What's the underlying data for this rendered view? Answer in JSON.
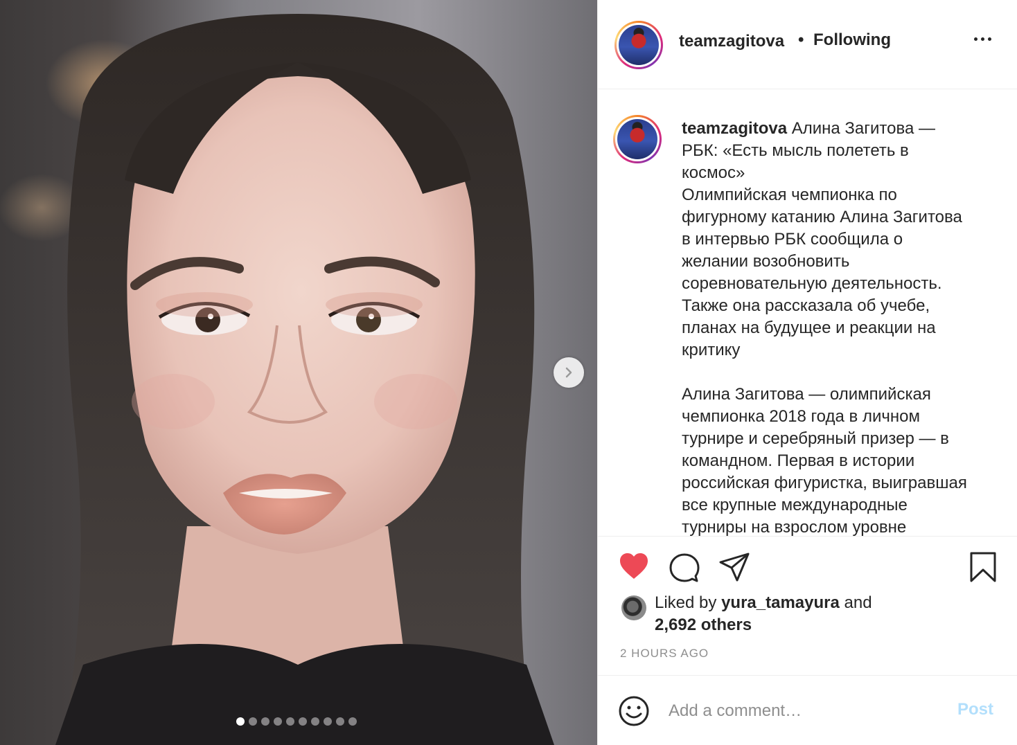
{
  "post": {
    "username": "teamzagitova",
    "separator": "•",
    "follow_status": "Following",
    "caption_lines": [
      "Алина Загитова —",
      "РБК: «Есть мысль полететь в",
      "космос»",
      "Олимпийская чемпионка по",
      "фигурному катанию Алина Загитова",
      "в интервью РБК сообщила о",
      "желании возобновить",
      "соревновательную деятельность.",
      "Также она рассказала об учебе,",
      "планах на будущее и реакции на",
      "критику",
      "",
      "Алина Загитова — олимпийская",
      "чемпионка 2018 года в личном",
      "турнире и серебряный призер — в",
      "командном. Первая в истории",
      "российская фигуристка, выигравшая",
      "все крупные международные",
      "турниры на взрослом уровне"
    ],
    "liked_prefix": "Liked by",
    "liked_user": "yura_tamayura",
    "liked_and": "and",
    "likes_others": "2,692 others",
    "timestamp": "2 HOURS AGO",
    "comment_placeholder": "Add a comment…",
    "post_label": "Post",
    "carousel": {
      "slide_count": 10,
      "current_slide": 1
    }
  },
  "icons": {
    "like": "heart-icon",
    "comment": "comment-icon",
    "share": "paper-plane-icon",
    "save": "bookmark-icon",
    "emoji": "smiley-icon",
    "next": "chevron-right-icon",
    "more": "more-options-icon"
  },
  "colors": {
    "like_active": "#ed4956",
    "post_disabled": "#b2dffc",
    "muted_text": "#8e8e8e",
    "divider": "#efefef"
  }
}
